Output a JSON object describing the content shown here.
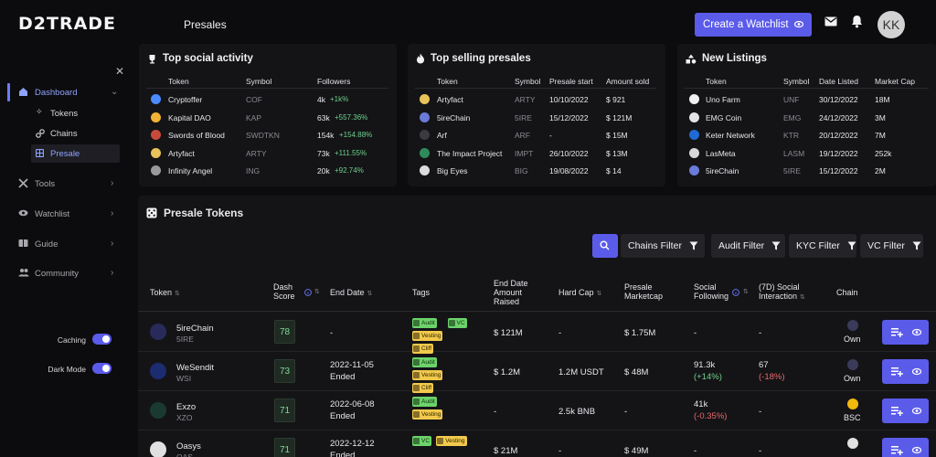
{
  "header": {
    "logo": "D2TRADE",
    "page_title": "Presales",
    "create_watchlist": "Create a Watchlist",
    "avatar_initials": "KK"
  },
  "sidebar": {
    "items": [
      {
        "label": "Dashboard",
        "icon": "home-icon",
        "active": true
      },
      {
        "label": "Tools",
        "icon": "tools-icon"
      },
      {
        "label": "Watchlist",
        "icon": "eye-icon"
      },
      {
        "label": "Guide",
        "icon": "book-icon"
      },
      {
        "label": "Community",
        "icon": "people-icon"
      }
    ],
    "subitems": [
      {
        "label": "Tokens",
        "icon": "sparkle-icon"
      },
      {
        "label": "Chains",
        "icon": "link-icon"
      },
      {
        "label": "Presale",
        "icon": "grid-icon",
        "active": true
      }
    ],
    "caching_label": "Caching",
    "dark_mode_label": "Dark Mode",
    "caching_on": true,
    "dark_mode_on": true
  },
  "social": {
    "title": "Top social activity",
    "headers": [
      "Token",
      "Symbol",
      "Followers"
    ],
    "rows": [
      {
        "name": "Cryptoffer",
        "symbol": "COF",
        "followers": "4k",
        "change": "+1k%",
        "color": "#4a8cff"
      },
      {
        "name": "Kapital DAO",
        "symbol": "KAP",
        "followers": "63k",
        "change": "+557.36%",
        "color": "#f2b233"
      },
      {
        "name": "Swords of Blood",
        "symbol": "SWDTKN",
        "followers": "154k",
        "change": "+154.88%",
        "color": "#c94a3a"
      },
      {
        "name": "Artyfact",
        "symbol": "ARTY",
        "followers": "73k",
        "change": "+111.55%",
        "color": "#e8c35a"
      },
      {
        "name": "Infinity Angel",
        "symbol": "ING",
        "followers": "20k",
        "change": "+92.74%",
        "color": "#9a9a9a"
      }
    ]
  },
  "selling": {
    "title": "Top selling presales",
    "headers": [
      "Token",
      "Symbol",
      "Presale start",
      "Amount sold"
    ],
    "rows": [
      {
        "name": "Artyfact",
        "symbol": "ARTY",
        "start": "10/10/2022",
        "amount": "$ 921",
        "color": "#e8c35a"
      },
      {
        "name": "5ireChain",
        "symbol": "5IRE",
        "start": "15/12/2022",
        "amount": "$ 121M",
        "color": "#6a7bd8"
      },
      {
        "name": "Arf",
        "symbol": "ARF",
        "start": "-",
        "amount": "$ 15M",
        "color": "#3a3a40"
      },
      {
        "name": "The Impact Project",
        "symbol": "IMPT",
        "start": "26/10/2022",
        "amount": "$ 13M",
        "color": "#2f8a5a"
      },
      {
        "name": "Big Eyes",
        "symbol": "BIG",
        "start": "19/08/2022",
        "amount": "$ 14",
        "color": "#dcdcdc"
      }
    ]
  },
  "listings": {
    "title": "New Listings",
    "headers": [
      "Token",
      "Symbol",
      "Date Listed",
      "Market Cap"
    ],
    "rows": [
      {
        "name": "Uno Farm",
        "symbol": "UNF",
        "date": "30/12/2022",
        "cap": "18M",
        "color": "#f0f0f0"
      },
      {
        "name": "EMG Coin",
        "symbol": "EMG",
        "date": "24/12/2022",
        "cap": "3M",
        "color": "#e4e4e4"
      },
      {
        "name": "Keter Network",
        "symbol": "KTR",
        "date": "20/12/2022",
        "cap": "7M",
        "color": "#1f6ad4"
      },
      {
        "name": "LasMeta",
        "symbol": "LASM",
        "date": "19/12/2022",
        "cap": "252k",
        "color": "#d8d8d8"
      },
      {
        "name": "5ireChain",
        "symbol": "5IRE",
        "date": "15/12/2022",
        "cap": "2M",
        "color": "#6a7bd8"
      }
    ]
  },
  "presale": {
    "title": "Presale Tokens",
    "filters": [
      "Chains Filter",
      "Audit Filter",
      "KYC Filter",
      "VC Filter"
    ],
    "columns": {
      "token": "Token",
      "dash_score_1": "Dash",
      "dash_score_2": "Score",
      "end_date": "End Date",
      "tags": "Tags",
      "amount_1": "End Date",
      "amount_2": "Amount",
      "amount_3": "Raised",
      "hard_cap": "Hard Cap",
      "mcap_1": "Presale",
      "mcap_2": "Marketcap",
      "social_1": "Social",
      "social_2": "Following",
      "interaction_1": "(7D) Social",
      "interaction_2": "Interaction",
      "chain": "Chain"
    },
    "rows": [
      {
        "name": "5ireChain",
        "symbol": "5IRE",
        "score": "78",
        "date": "-",
        "status": "",
        "tags": [
          "Audit",
          "VC",
          "Vesting",
          "Cliff"
        ],
        "amount": "$ 121M",
        "hardcap": "-",
        "mcap": "$ 1.75M",
        "social": "-",
        "social_change": "",
        "interaction": "-",
        "interaction_change": "",
        "chain": "Own",
        "color": "#2a2a5a"
      },
      {
        "name": "WeSendit",
        "symbol": "WSI",
        "score": "73",
        "date": "2022-11-05",
        "status": "Ended",
        "tags": [
          "Audit",
          "Vesting",
          "Cliff"
        ],
        "amount": "$ 1.2M",
        "hardcap": "1.2M  USDT",
        "mcap": "$ 48M",
        "social": "91.3k",
        "social_change": "(+14%)",
        "interaction": "67",
        "interaction_change": "(-18%)",
        "chain": "Own",
        "color": "#1c2c70"
      },
      {
        "name": "Exzo",
        "symbol": "XZO",
        "score": "71",
        "date": "2022-06-08",
        "status": "Ended",
        "tags": [
          "Audit",
          "Vesting"
        ],
        "amount": "-",
        "hardcap": "2.5k  BNB",
        "mcap": "-",
        "social": "41k",
        "social_change": "(-0.35%)",
        "interaction": "-",
        "interaction_change": "",
        "chain": "BSC",
        "color": "#1a3a30"
      },
      {
        "name": "Oasys",
        "symbol": "OAS",
        "score": "71",
        "date": "2022-12-12",
        "status": "Ended",
        "tags": [
          "VC",
          "Vesting"
        ],
        "amount": "$ 21M",
        "hardcap": "-",
        "mcap": "$ 49M",
        "social": "-",
        "social_change": "",
        "interaction": "-",
        "interaction_change": "",
        "chain": "",
        "color": "#e0e0e0"
      }
    ]
  },
  "colors": {
    "accent": "#5b5bea",
    "positive": "#6fd08c",
    "negative": "#e86a6a",
    "tag_yellow": "#f2c94c",
    "tag_green": "#6cd36a"
  }
}
